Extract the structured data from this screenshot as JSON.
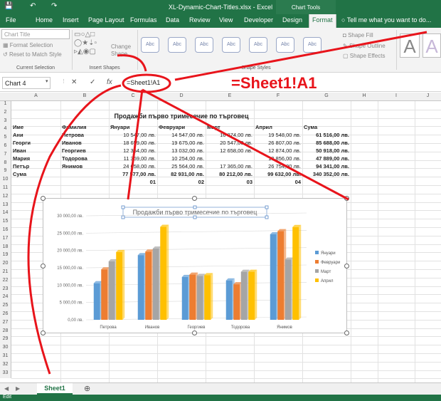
{
  "titlebar": {
    "title": "XL-Dynamic-Chart-Titles.xlsx - Excel",
    "context_tab": "Chart Tools",
    "save_icon": "save-icon",
    "undo_icon": "undo-icon",
    "redo_icon": "redo-icon"
  },
  "tabs": [
    "File",
    "Home",
    "Insert",
    "Page Layout",
    "Formulas",
    "Data",
    "Review",
    "View",
    "Developer",
    "Design",
    "Format"
  ],
  "active_tab": "Format",
  "tell_me": "Tell me what you want to do...",
  "ribbon": {
    "chart_element": "Chart Title",
    "format_selection": "Format Selection",
    "reset_to_match": "Reset to Match Style",
    "current_selection_label": "Current Selection",
    "insert_shapes_label": "Insert Shapes",
    "change_shape_partial": "Change\nShape",
    "shape_styles_label": "Shape Styles",
    "shape_style_text": "Abc",
    "shape_fill": "Shape Fill",
    "shape_outline": "Shape Outline",
    "shape_effects": "Shape Effects",
    "wordart_letter": "A"
  },
  "formula_bar": {
    "name_box": "Chart 4",
    "formula": "=Sheet1!A1",
    "cancel_icon": "x-icon",
    "enter_icon": "check-icon",
    "fx": "fx"
  },
  "annotation": {
    "big_formula": "=Sheet1!A1",
    "color": "#e8141b"
  },
  "columns": [
    "A",
    "B",
    "C",
    "D",
    "E",
    "F",
    "G",
    "H",
    "I",
    "J"
  ],
  "rows": [
    "1",
    "2",
    "3",
    "4",
    "5",
    "6",
    "7",
    "8",
    "9",
    "10",
    "11",
    "12",
    "13",
    "14",
    "15",
    "16",
    "17",
    "18",
    "19",
    "20",
    "21",
    "22",
    "23",
    "24",
    "25",
    "26",
    "27",
    "28",
    "29",
    "30",
    "31",
    "32",
    "33"
  ],
  "table": {
    "title": "Продажби първо тримесечие по търговец",
    "headers": [
      "Име",
      "Фамилия",
      "Януари",
      "Февруари",
      "Март",
      "Април",
      "Сума"
    ],
    "rows": [
      [
        "Ани",
        "Петрова",
        "10 547,00 лв.",
        "14 547,00 лв.",
        "16 874,00 лв.",
        "19 548,00 лв.",
        "61 516,00 лв."
      ],
      [
        "Георги",
        "Иванов",
        "18 659,00 лв.",
        "19 675,00 лв.",
        "20 547,00 лв.",
        "26 807,00 лв.",
        "85 688,00 лв."
      ],
      [
        "Иван",
        "Георгиев",
        "12 354,00 лв.",
        "13 032,00 лв.",
        "12 658,00 лв.",
        "12 874,00 лв.",
        "50 918,00 лв."
      ],
      [
        "Мария",
        "Тодорова",
        "11 359,00 лв.",
        "10 254,00 лв.",
        "13 856,00 лв.",
        "47 889,00 лв."
      ],
      [
        "Петър",
        "Янимов",
        "24 658,00 лв.",
        "25 564,00 лв.",
        "17 365,00 лв.",
        "26 754,00 лв.",
        "94 341,00 лв."
      ]
    ],
    "totals": [
      "Сума",
      "",
      "77 577,00 лв.",
      "82 931,00 лв.",
      "80 212,00 лв.",
      "99 632,00 лв.",
      "340 352,00 лв."
    ],
    "row9": [
      "",
      "",
      "01",
      "02",
      "03",
      "04",
      ""
    ]
  },
  "chart_data": {
    "type": "bar",
    "title": "Продажби първо тримесечие по търговец",
    "categories": [
      "Петрова",
      "Иванов",
      "Георгиев",
      "Тодорова",
      "Янимов"
    ],
    "series": [
      {
        "name": "Януари",
        "color": "#5b9bd5",
        "values": [
          10547,
          18659,
          12354,
          11359,
          24658
        ]
      },
      {
        "name": "Февруари",
        "color": "#ed7d31",
        "values": [
          14547,
          19675,
          13032,
          10254,
          25564
        ]
      },
      {
        "name": "Март",
        "color": "#a5a5a5",
        "values": [
          16874,
          20547,
          12658,
          13856,
          17365
        ]
      },
      {
        "name": "Април",
        "color": "#ffc000",
        "values": [
          19548,
          26807,
          12874,
          13856,
          26754
        ]
      }
    ],
    "yticks": [
      "0,00 лв.",
      "5 000,00 лв.",
      "10 000,00 лв.",
      "15 000,00 лв.",
      "20 000,00 лв.",
      "25 000,00 лв.",
      "30 000,00 лв."
    ],
    "ylim": [
      0,
      30000
    ],
    "legend_position": "right"
  },
  "sheet_tab": "Sheet1",
  "add_sheet_icon": "plus-icon",
  "status": "Edit"
}
